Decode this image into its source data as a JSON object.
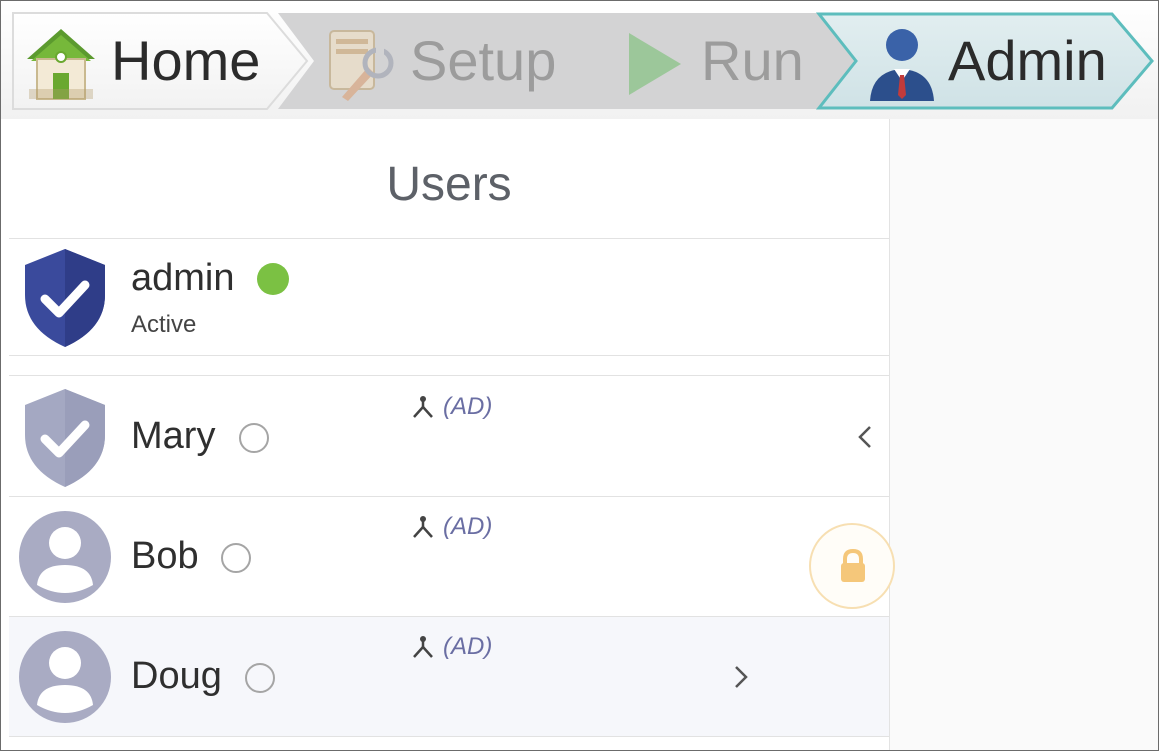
{
  "breadcrumb": {
    "steps": [
      {
        "label": "Home",
        "state": "completed",
        "icon": "house-icon"
      },
      {
        "label": "Setup",
        "state": "disabled",
        "icon": "setup-wrench-icon"
      },
      {
        "label": "Run",
        "state": "disabled",
        "icon": "play-icon"
      },
      {
        "label": "Admin",
        "state": "active",
        "icon": "admin-user-icon"
      }
    ]
  },
  "users_panel": {
    "title": "Users",
    "current_user": {
      "name": "admin",
      "status": "Active",
      "presence": "online",
      "icon": "shield-check-icon"
    },
    "users": [
      {
        "name": "Mary",
        "presence": "offline",
        "badge": "(AD)",
        "icon": "shield-check-icon",
        "chevron": "‹"
      },
      {
        "name": "Bob",
        "presence": "offline",
        "badge": "(AD)",
        "icon": "user-avatar-icon",
        "chevron": "‹"
      },
      {
        "name": "Doug",
        "presence": "offline",
        "badge": "(AD)",
        "icon": "user-avatar-icon",
        "chevron": "›"
      }
    ]
  },
  "colors": {
    "active_step_fill": "#d7e7ea",
    "active_step_border": "#5dbdbd",
    "disabled_step_fill": "#d3d3d4",
    "online": "#7bc143",
    "shield_admin": "#3a4a9c",
    "shield_user": "#a4a8c2",
    "avatar": "#a9abc3",
    "ad_text": "#6a6ea3",
    "lock": "#f5c77a"
  }
}
